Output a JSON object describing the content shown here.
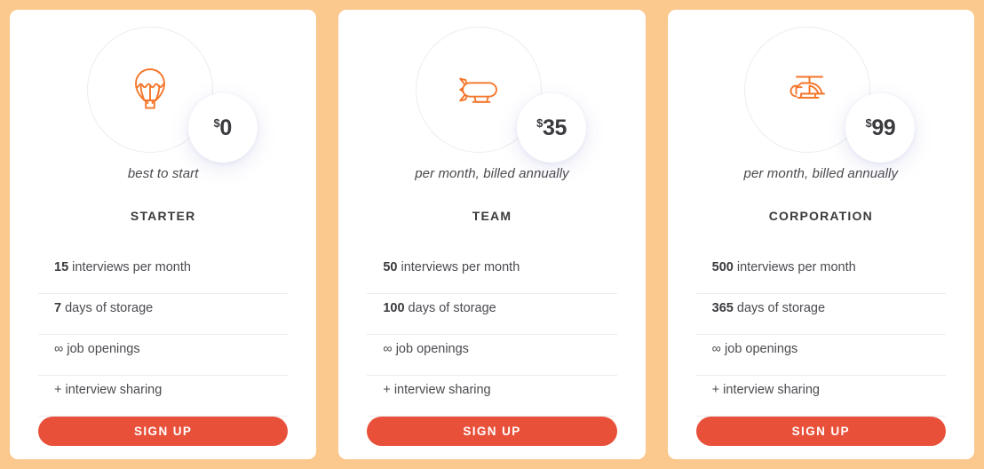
{
  "theme": {
    "page_background": "#fbc88d",
    "card_background": "#ffffff",
    "icon_color": "#f4762a",
    "button_color": "#e8503a",
    "button_text_color": "#ffffff",
    "heading_color": "#3b3b3f",
    "divider_color": "#ececec",
    "ring_color": "#ededed"
  },
  "plans": [
    {
      "icon": "hot-air-balloon-icon",
      "currency": "$",
      "price": "0",
      "tagline": "best to start",
      "name": "STARTER",
      "features": [
        {
          "qty": "15",
          "text": " interviews per month"
        },
        {
          "qty": "7",
          "text": " days of storage"
        },
        {
          "qty": "∞",
          "text": " job openings",
          "symbol": true
        },
        {
          "qty": "+",
          "text": " interview sharing",
          "symbol": true
        }
      ],
      "cta": "SIGN UP"
    },
    {
      "icon": "zeppelin-icon",
      "currency": "$",
      "price": "35",
      "tagline": "per month, billed annually",
      "name": "TEAM",
      "features": [
        {
          "qty": "50",
          "text": " interviews per month"
        },
        {
          "qty": "100",
          "text": " days of storage"
        },
        {
          "qty": "∞",
          "text": " job openings",
          "symbol": true
        },
        {
          "qty": "+",
          "text": " interview sharing",
          "symbol": true
        }
      ],
      "cta": "SIGN UP"
    },
    {
      "icon": "helicopter-icon",
      "currency": "$",
      "price": "99",
      "tagline": "per month, billed annually",
      "name": "CORPORATION",
      "features": [
        {
          "qty": "500",
          "text": " interviews per month"
        },
        {
          "qty": "365",
          "text": " days of storage"
        },
        {
          "qty": "∞",
          "text": " job openings",
          "symbol": true
        },
        {
          "qty": "+",
          "text": " interview sharing",
          "symbol": true
        }
      ],
      "cta": "SIGN UP"
    }
  ]
}
